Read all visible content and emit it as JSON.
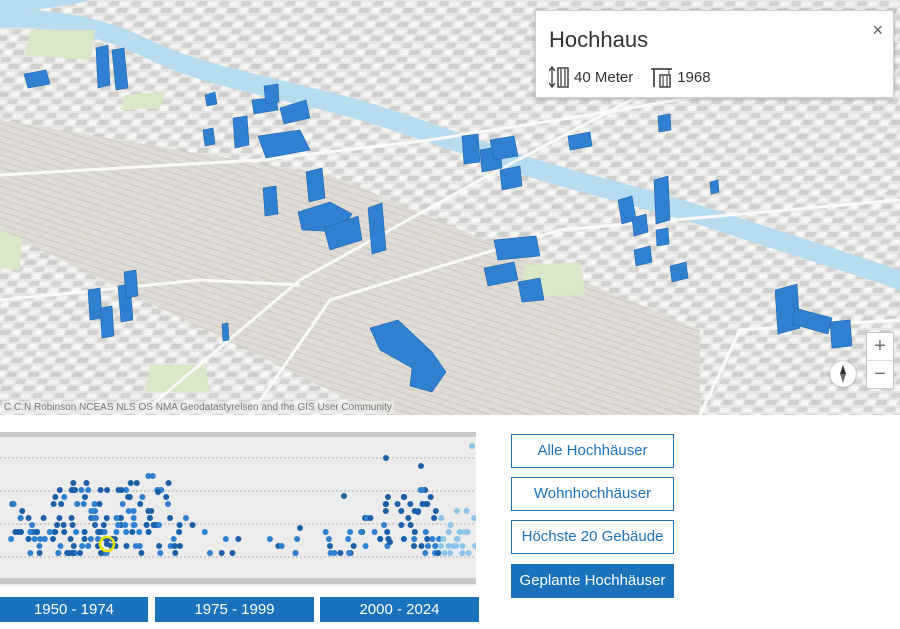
{
  "map": {
    "attribution": "C C.N Robinson NCEAS NLS OS NMA Geodatastyrelsen and the GIS User Community"
  },
  "popup": {
    "title": "Hochhaus",
    "close_symbol": "×",
    "height_value": "40 Meter",
    "year_value": "1968",
    "icons": [
      "building-height-icon",
      "crane-icon"
    ]
  },
  "zoom": {
    "in_label": "+",
    "out_label": "−"
  },
  "filters": [
    {
      "label": "Alle Hochhäuser",
      "active": false
    },
    {
      "label": "Wohnhochhäuser",
      "active": false
    },
    {
      "label": "Höchste 20 Gebäude",
      "active": false
    },
    {
      "label": "Geplante Hochhäuser",
      "active": true
    }
  ],
  "decades": [
    "1950 - 1974",
    "1975 - 1999",
    "2000 - 2024"
  ],
  "colors": {
    "accent": "#1a72bd",
    "building": "#2f80d0",
    "dot_dark": "#1a5fa8",
    "dot_light": "#8cc4ea",
    "highlight": "#e6e600"
  }
}
